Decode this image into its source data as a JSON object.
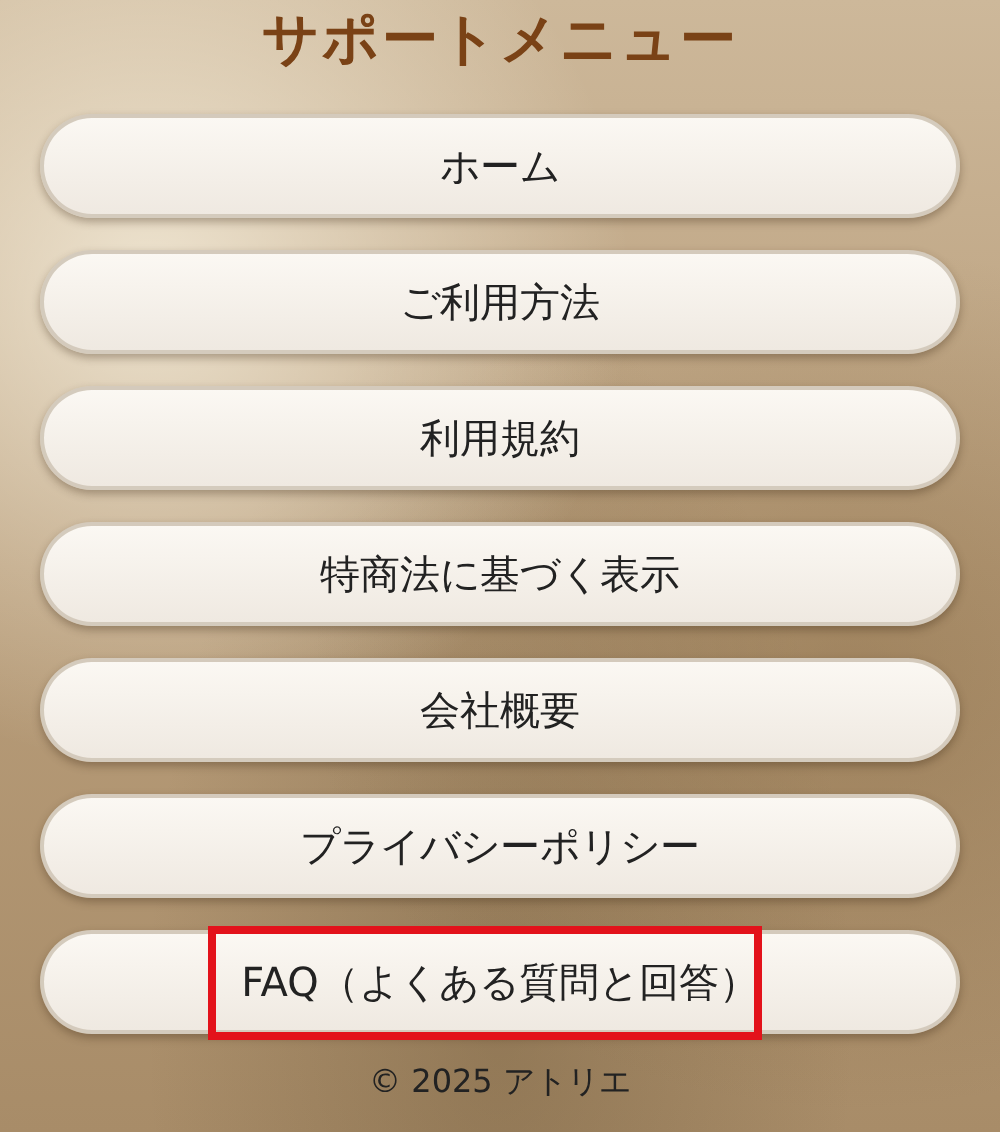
{
  "title": "サポートメニュー",
  "menu": [
    {
      "label": "ホーム",
      "highlighted": false
    },
    {
      "label": "ご利用方法",
      "highlighted": false
    },
    {
      "label": "利用規約",
      "highlighted": false
    },
    {
      "label": "特商法に基づく表示",
      "highlighted": false
    },
    {
      "label": "会社概要",
      "highlighted": false
    },
    {
      "label": "プライバシーポリシー",
      "highlighted": false
    },
    {
      "label": "FAQ（よくある質問と回答）",
      "highlighted": true
    }
  ],
  "footer": "© 2025 アトリエ"
}
